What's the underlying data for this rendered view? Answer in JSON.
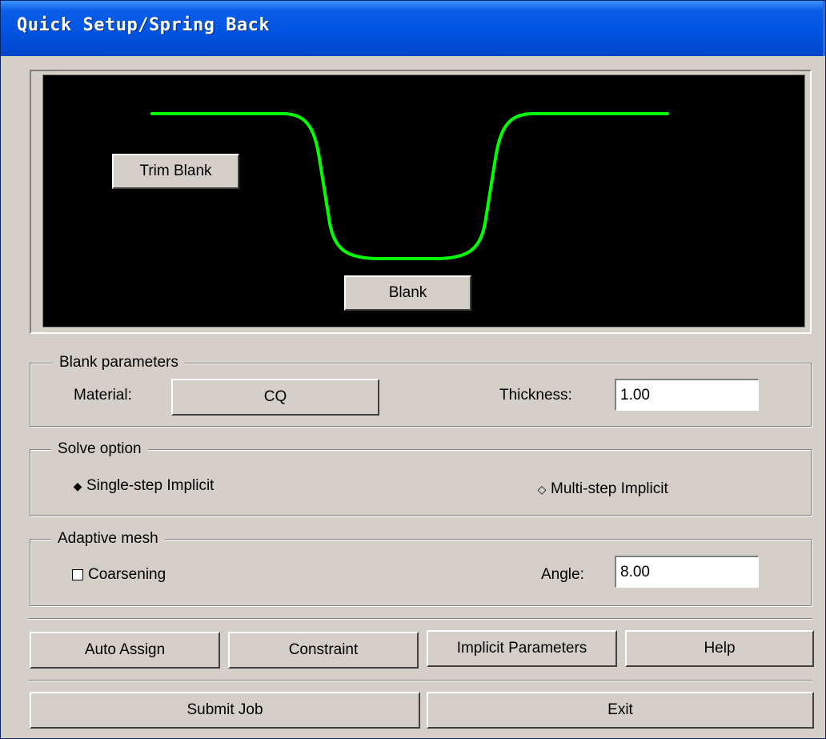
{
  "window": {
    "title": "Quick Setup/Spring Back"
  },
  "preview": {
    "trim_blank_label": "Trim Blank",
    "blank_label": "Blank",
    "curve_color": "#00ff00",
    "background": "#000000"
  },
  "blank_parameters": {
    "legend": "Blank parameters",
    "material_label": "Material:",
    "material_value": "CQ",
    "thickness_label": "Thickness:",
    "thickness_value": "1.00"
  },
  "solve_option": {
    "legend": "Solve option",
    "options": [
      {
        "label": "Single-step Implicit",
        "selected": true
      },
      {
        "label": "Multi-step Implicit",
        "selected": false
      }
    ]
  },
  "adaptive_mesh": {
    "legend": "Adaptive mesh",
    "coarsening_label": "Coarsening",
    "coarsening_checked": false,
    "angle_label": "Angle:",
    "angle_value": "8.00"
  },
  "actions": {
    "auto_assign": "Auto Assign",
    "constraint": "Constraint",
    "implicit_parameters": "Implicit Parameters",
    "help": "Help",
    "submit_job": "Submit Job",
    "exit": "Exit"
  }
}
